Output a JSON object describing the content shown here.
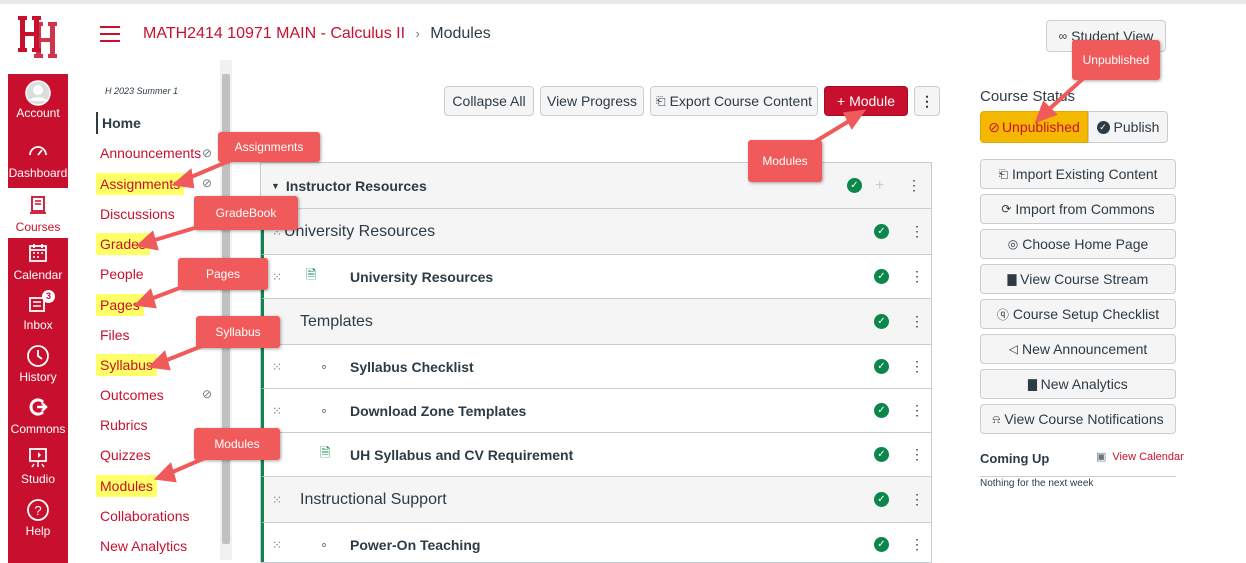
{
  "header": {
    "course": "MATH2414 10971 MAIN - Calculus II",
    "separator": "›",
    "page": "Modules",
    "student_view": "Student View"
  },
  "global_nav": [
    {
      "label": "Account"
    },
    {
      "label": "Dashboard"
    },
    {
      "label": "Courses"
    },
    {
      "label": "Calendar"
    },
    {
      "label": "Inbox",
      "badge": "3"
    },
    {
      "label": "History"
    },
    {
      "label": "Commons"
    },
    {
      "label": "Studio"
    },
    {
      "label": "Help"
    }
  ],
  "course_nav": {
    "term": "H 2023 Summer 1",
    "items": [
      {
        "label": "Home"
      },
      {
        "label": "Announcements"
      },
      {
        "label": "Assignments"
      },
      {
        "label": "Discussions"
      },
      {
        "label": "Grades"
      },
      {
        "label": "People"
      },
      {
        "label": "Pages"
      },
      {
        "label": "Files"
      },
      {
        "label": "Syllabus"
      },
      {
        "label": "Outcomes"
      },
      {
        "label": "Rubrics"
      },
      {
        "label": "Quizzes"
      },
      {
        "label": "Modules"
      },
      {
        "label": "Collaborations"
      },
      {
        "label": "New Analytics"
      }
    ]
  },
  "toolbar": {
    "collapse_all": "Collapse All",
    "view_progress": "View Progress",
    "export": "Export Course Content",
    "add_module": "+ Module"
  },
  "modules": [
    {
      "title": "Instructor Resources",
      "type": "header"
    },
    {
      "title": "University Resources",
      "type": "module"
    },
    {
      "title": "University Resources",
      "type": "item"
    },
    {
      "title": "Templates",
      "type": "module"
    },
    {
      "title": "Syllabus Checklist",
      "type": "item"
    },
    {
      "title": "Download Zone Templates",
      "type": "item"
    },
    {
      "title": "UH Syllabus and CV Requirement",
      "type": "item"
    },
    {
      "title": "Instructional Support",
      "type": "module"
    },
    {
      "title": "Power-On Teaching",
      "type": "item"
    }
  ],
  "status": {
    "heading": "Course Status",
    "unpublished": "Unpublished",
    "publish": "Publish"
  },
  "sidebar_actions": {
    "import": "Import Existing Content",
    "commons": "Import from Commons",
    "home": "Choose Home Page",
    "stream": "View Course Stream",
    "checklist": "Course Setup Checklist",
    "announcement": "New Announcement",
    "analytics": "New Analytics",
    "notifications": "View Course Notifications"
  },
  "coming_up": {
    "title": "Coming Up",
    "view_calendar": "View Calendar",
    "empty": "Nothing for the next week"
  },
  "annotations": {
    "assignments": "Assignments",
    "gradebook": "GradeBook",
    "pages": "Pages",
    "syllabus": "Syllabus",
    "modules_nav": "Modules",
    "modules_btn": "Modules",
    "unpublished": "Unpublished"
  },
  "colors": {
    "brand_red": "#c8102e",
    "callout": "#f05a5a",
    "highlight": "#ffff66",
    "unpublished": "#f5b800",
    "green": "#0b874b"
  }
}
